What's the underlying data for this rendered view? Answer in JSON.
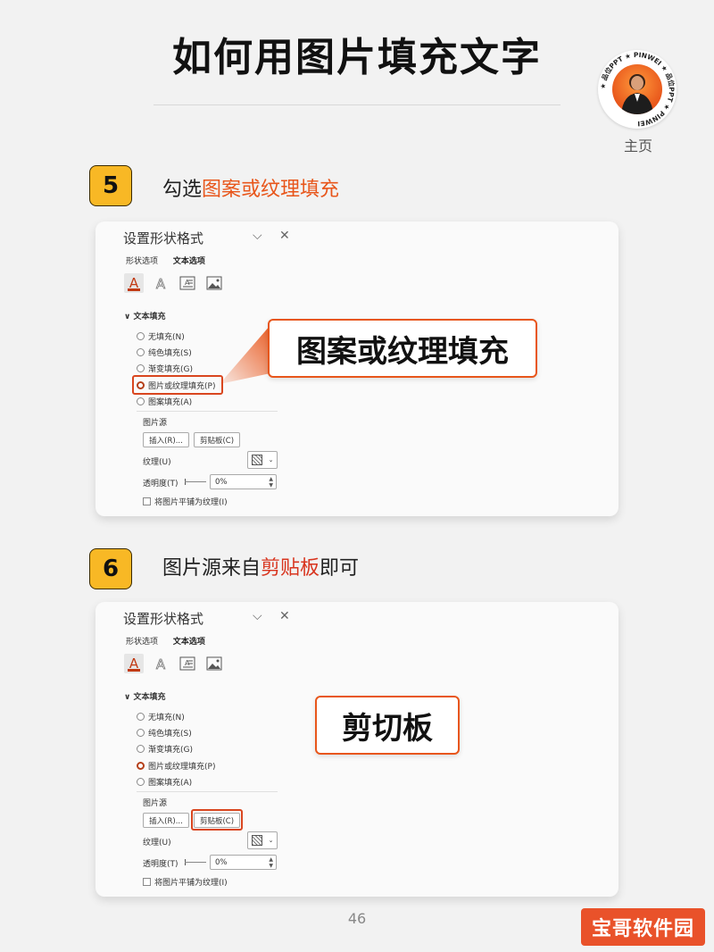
{
  "header": {
    "title": "如何用图片填充文字",
    "avatar_ring": "★ 品位PPT ★ PINWEI ★ 品位PPT ★ PINWEI ",
    "home_label": "主页"
  },
  "steps": [
    {
      "number": "5",
      "heading_prefix": "勾选",
      "heading_highlight": "图案或纹理填充",
      "heading_suffix": "",
      "callout": "图案或纹理填充"
    },
    {
      "number": "6",
      "heading_prefix": "图片源来自",
      "heading_highlight": "剪贴板",
      "heading_suffix": "即可",
      "callout": "剪切板"
    }
  ],
  "pane": {
    "title": "设置形状格式",
    "collapse_glyph": "⌵",
    "close_glyph": "✕",
    "tabs": [
      "形状选项",
      "文本选项"
    ],
    "icons": [
      "text-fill-outline-icon",
      "text-effects-icon",
      "text-box-icon",
      "picture-icon"
    ],
    "text_fill_glyph": "A",
    "text_effect_glyph": "A",
    "section": "文本填充",
    "section_chevron": "∨",
    "fill_options": [
      "无填充(N)",
      "纯色填充(S)",
      "渐变填充(G)",
      "图片或纹理填充(P)",
      "图案填充(A)"
    ],
    "selected_option": "图片或纹理填充(P)",
    "picture_source": "图片源",
    "insert_button": "插入(R)...",
    "clipboard_button": "剪贴板(C)",
    "texture_label": "纹理(U)",
    "texture_arrow": "⌄",
    "transparency_label": "透明度(T)",
    "transparency_value": "0%",
    "tile_checkbox": "将图片平铺为纹理(I)"
  },
  "footer": {
    "page_number": "46",
    "watermark": "宝哥软件园"
  },
  "colors": {
    "accent_orange": "#e8561b",
    "badge_yellow": "#f8b825",
    "highlight_red": "#d8341e",
    "watermark_bg": "#e9522a"
  }
}
